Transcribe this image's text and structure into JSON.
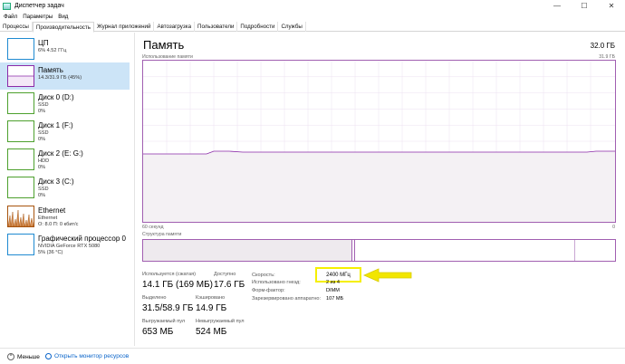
{
  "window": {
    "title": "Диспетчер задач",
    "controls": {
      "minimize": "—",
      "maximize": "☐",
      "close": "✕"
    }
  },
  "menu": [
    "Файл",
    "Параметры",
    "Вид"
  ],
  "tabs": [
    "Процессы",
    "Производительность",
    "Журнал приложений",
    "Автозагрузка",
    "Пользователи",
    "Подробности",
    "Службы"
  ],
  "active_tab": 1,
  "sidebar": {
    "items": [
      {
        "title": "ЦП",
        "sub1": "6% 4.52 ГГц",
        "sub2": "",
        "sub3": "",
        "color": "#1f8ad1",
        "icon": "cpu-thumbnail"
      },
      {
        "title": "Память",
        "sub1": "14.3/31.9 ГБ (45%)",
        "sub2": "",
        "sub3": "",
        "color": "#8b2aa8",
        "icon": "memory-thumbnail",
        "selected": true
      },
      {
        "title": "Диск 0 (D:)",
        "sub1": "SSD",
        "sub2": "0%",
        "sub3": "",
        "color": "#4da02d",
        "icon": "disk-thumbnail"
      },
      {
        "title": "Диск 1 (F:)",
        "sub1": "SSD",
        "sub2": "0%",
        "sub3": "",
        "color": "#4da02d",
        "icon": "disk-thumbnail"
      },
      {
        "title": "Диск 2 (E: G:)",
        "sub1": "HDD",
        "sub2": "0%",
        "sub3": "",
        "color": "#4da02d",
        "icon": "disk-thumbnail"
      },
      {
        "title": "Диск 3 (C:)",
        "sub1": "SSD",
        "sub2": "0%",
        "sub3": "",
        "color": "#4da02d",
        "icon": "disk-thumbnail"
      },
      {
        "title": "Ethernet",
        "sub1": "Ethernet",
        "sub2": "О: 8.0  П: 0 кбит/с",
        "sub3": "",
        "color": "#a7530d",
        "icon": "ethernet-thumbnail"
      },
      {
        "title": "Графический процессор 0",
        "sub1": "NVIDIA GeForce RTX 5080",
        "sub2": "5% (36 °C)",
        "sub3": "",
        "color": "#1f8ad1",
        "icon": "gpu-thumbnail"
      }
    ]
  },
  "main": {
    "heading": "Память",
    "total": "32.0 ГБ",
    "graph_label": "Использование памяти",
    "graph_max": "31.9 ГБ",
    "graph_left_label": "60 секунд",
    "graph_right_label": "0",
    "struct_label": "Структура памяти",
    "stats": {
      "in_use_label": "Используется (сжатая)",
      "in_use_value": "14.1 ГБ (169 МБ)",
      "available_label": "Доступно",
      "available_value": "17.6 ГБ",
      "committed_label": "Выделено",
      "committed_value": "31.5/58.9 ГБ",
      "cached_label": "Кэшировано",
      "cached_value": "14.9 ГБ",
      "paged_label": "Выгружаемый пул",
      "paged_value": "653 МБ",
      "nonpaged_label": "Невыгружаемый пул",
      "nonpaged_value": "524 МБ"
    },
    "info": {
      "speed_label": "Скорость:",
      "speed_value": "2400 МГц",
      "slots_label": "Использовано гнезд:",
      "slots_value": "2 из 4",
      "form_label": "Форм-фактор:",
      "form_value": "DIMM",
      "reserved_label": "Зарезервировано аппаратно:",
      "reserved_value": "107 МБ"
    },
    "usage_fraction": 0.45,
    "accent_color": "#a15fb1",
    "highlight_color": "#f5ef00"
  },
  "footer": {
    "less": "Меньше",
    "monitor": "Открыть монитор ресурсов"
  }
}
